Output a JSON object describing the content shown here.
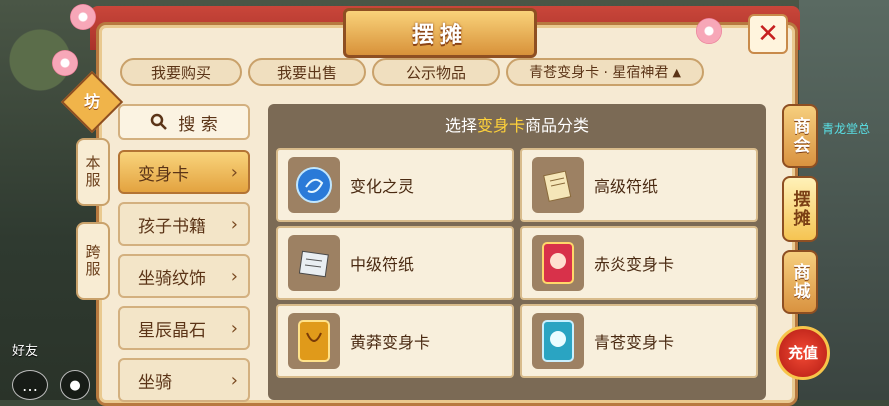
{
  "window": {
    "title": "摆摊"
  },
  "top_tabs": [
    {
      "label": "我要购买"
    },
    {
      "label": "我要出售"
    },
    {
      "label": "公示物品"
    },
    {
      "label": "青苍变身卡 · 星宿神君",
      "has_dropdown": true
    }
  ],
  "side_badge": "坊",
  "side_tabs": [
    {
      "label": "本服"
    },
    {
      "label": "跨服"
    }
  ],
  "search": {
    "label": "搜 索",
    "icon": "search-icon"
  },
  "categories": [
    {
      "label": "变身卡",
      "active": true
    },
    {
      "label": "孩子书籍",
      "active": false
    },
    {
      "label": "坐骑纹饰",
      "active": false
    },
    {
      "label": "星辰晶石",
      "active": false
    },
    {
      "label": "坐骑",
      "active": false
    }
  ],
  "content": {
    "title_prefix": "选择",
    "title_highlight": "变身卡",
    "title_suffix": "商品分类",
    "items": [
      {
        "label": "变化之灵",
        "icon": "blue-orb-icon"
      },
      {
        "label": "高级符纸",
        "icon": "scroll-paper-icon"
      },
      {
        "label": "中级符纸",
        "icon": "book-paper-icon"
      },
      {
        "label": "赤炎变身卡",
        "icon": "red-card-icon"
      },
      {
        "label": "黄莽变身卡",
        "icon": "gold-card-icon"
      },
      {
        "label": "青苍变身卡",
        "icon": "teal-card-icon"
      }
    ]
  },
  "right_nav": [
    {
      "label": "商会",
      "active": false
    },
    {
      "label": "摆摊",
      "active": true
    },
    {
      "label": "商城",
      "active": false
    }
  ],
  "recharge": {
    "label": "充值"
  },
  "npc_name": "青龙堂总",
  "friend_label": "好友",
  "colors": {
    "highlight": "#ffd23a",
    "accent": "#d99340",
    "close_x": "#c61f1f"
  }
}
